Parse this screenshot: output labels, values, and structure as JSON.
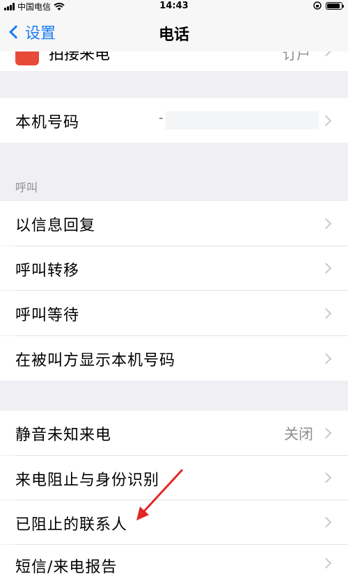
{
  "status_bar": {
    "carrier": "中国电信",
    "time": "14:43"
  },
  "nav": {
    "back_label": "设置",
    "title": "电话"
  },
  "top_cut_row": {
    "label": "拍接来电",
    "value": "订户"
  },
  "my_number": {
    "label": "本机号码",
    "value": "-"
  },
  "calls_section": {
    "header": "呼叫",
    "items": [
      "以信息回复",
      "呼叫转移",
      "呼叫等待",
      "在被叫方显示本机号码"
    ]
  },
  "bottom_section": {
    "silence": {
      "label": "静音未知来电",
      "value": "关闭"
    },
    "blocking": {
      "label": "来电阻止与身份识别"
    },
    "blocked_contacts": {
      "label": "已阻止的联系人"
    },
    "sms_report": {
      "label": "短信/来电报告"
    }
  }
}
